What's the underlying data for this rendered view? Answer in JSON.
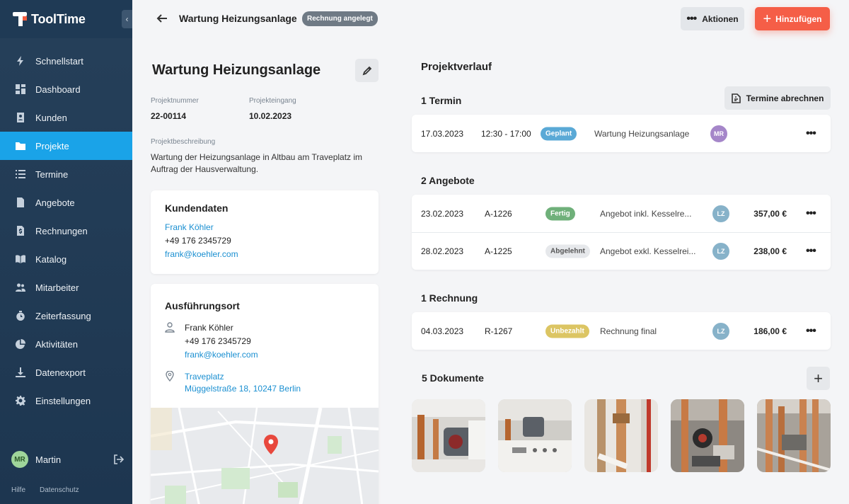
{
  "sidebar": {
    "brand": {
      "part1": "Tool",
      "part2": "Time"
    },
    "collapse_glyph": "‹",
    "items": [
      {
        "label": "Schnellstart",
        "icon": "bolt-icon"
      },
      {
        "label": "Dashboard",
        "icon": "grid-icon"
      },
      {
        "label": "Kunden",
        "icon": "contacts-icon"
      },
      {
        "label": "Projekte",
        "icon": "folder-icon",
        "active": true
      },
      {
        "label": "Termine",
        "icon": "list-icon"
      },
      {
        "label": "Angebote",
        "icon": "document-icon"
      },
      {
        "label": "Rechnungen",
        "icon": "invoice-icon"
      },
      {
        "label": "Katalog",
        "icon": "book-icon"
      },
      {
        "label": "Mitarbeiter",
        "icon": "people-icon"
      },
      {
        "label": "Zeiterfassung",
        "icon": "stopwatch-icon"
      },
      {
        "label": "Aktivitäten",
        "icon": "pie-icon"
      },
      {
        "label": "Datenexport",
        "icon": "download-icon"
      },
      {
        "label": "Einstellungen",
        "icon": "gear-icon"
      }
    ],
    "user": {
      "initials": "MR",
      "name": "Martin"
    },
    "footer": {
      "help": "Hilfe",
      "privacy": "Datenschutz"
    }
  },
  "header": {
    "title": "Wartung Heizungsanlage",
    "badge": "Rechnung angelegt",
    "actions_label": "Aktionen",
    "add_label": "Hinzufügen"
  },
  "project": {
    "title": "Wartung Heizungsanlage",
    "number_label": "Projektnummer",
    "number": "22-00114",
    "received_label": "Projekteingang",
    "received": "10.02.2023",
    "desc_label": "Projektbeschreibung",
    "desc": "Wartung der Heizungsanlage in Altbau am Traveplatz im Auftrag der Hausverwaltung."
  },
  "customer": {
    "title": "Kundendaten",
    "name": "Frank Köhler",
    "phone": "+49 176 2345729",
    "email": "frank@koehler.com"
  },
  "location": {
    "title": "Ausführungsort",
    "name": "Frank Köhler",
    "phone": "+49 176 2345729",
    "email": "frank@koehler.com",
    "place": "Traveplatz",
    "address": "Müggelstraße 18, 10247 Berlin"
  },
  "history": {
    "title": "Projektverlauf",
    "appointments": {
      "heading": "1 Termin",
      "button": "Termine abrechnen",
      "rows": [
        {
          "date": "17.03.2023",
          "time": "12:30 - 17:00",
          "status": "Geplant",
          "text": "Wartung Heizungsanlage",
          "initials": "MR"
        }
      ]
    },
    "offers": {
      "heading": "2 Angebote",
      "rows": [
        {
          "date": "23.02.2023",
          "id": "A-1226",
          "status": "Fertig",
          "text": "Angebot inkl. Kesselre...",
          "initials": "LZ",
          "amount": "357,00 €"
        },
        {
          "date": "28.02.2023",
          "id": "A-1225",
          "status": "Abgelehnt",
          "text": "Angebot exkl. Kesselrei...",
          "initials": "LZ",
          "amount": "238,00 €"
        }
      ]
    },
    "invoices": {
      "heading": "1 Rechnung",
      "rows": [
        {
          "date": "04.03.2023",
          "id": "R-1267",
          "status": "Unbezahlt",
          "text": "Rechnung final",
          "initials": "LZ",
          "amount": "186,00 €"
        }
      ]
    },
    "documents": {
      "heading": "5 Dokumente",
      "add_glyph": "+"
    }
  },
  "glyphs": {
    "more": "•••",
    "actions_dots": "•••",
    "plus": "+"
  },
  "colors": {
    "accent": "#1aa3e8",
    "brand_orange": "#f55e47",
    "sidebar": "#26405a"
  }
}
